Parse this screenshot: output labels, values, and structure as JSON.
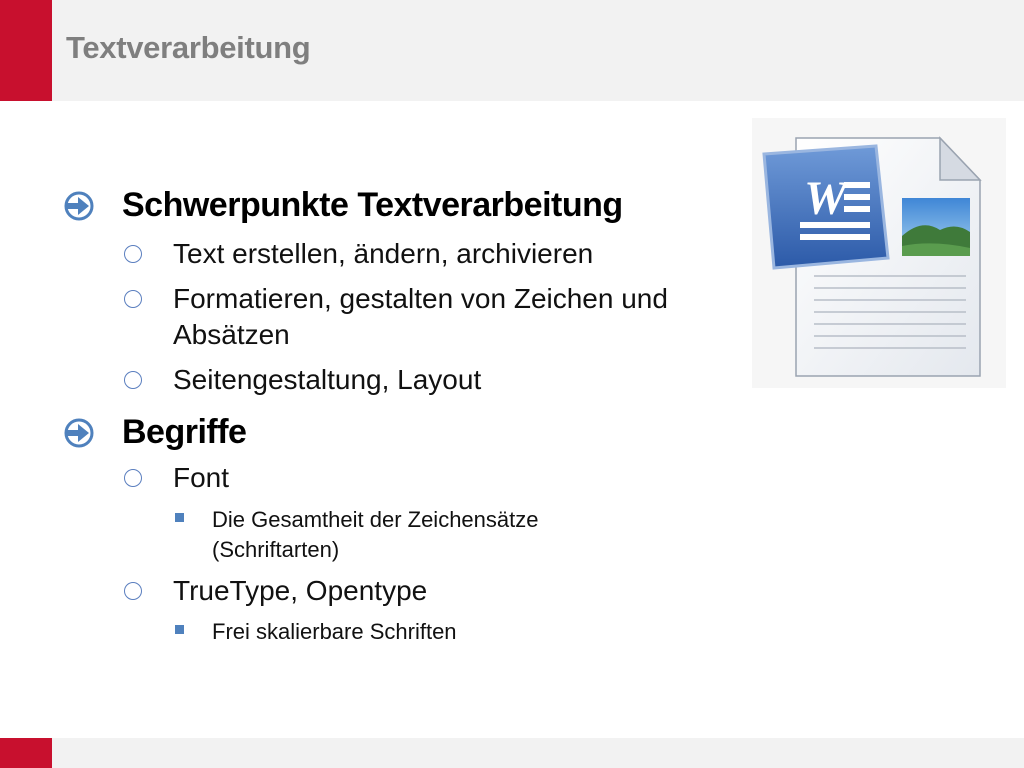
{
  "slide": {
    "title": "Textverarbeitung"
  },
  "bullets": {
    "b1": {
      "label": "Schwerpunkte Textverarbeitung"
    },
    "b1_1": {
      "label": "Text erstellen, ändern, archivieren"
    },
    "b1_2": {
      "line1": "Formatieren, gestalten von Zeichen und",
      "line2": "Absätzen"
    },
    "b1_3": {
      "label": "Seitengestaltung, Layout"
    },
    "b2": {
      "label": "Begriffe"
    },
    "b2_1": {
      "label": "Font"
    },
    "b2_1_1": {
      "line1": "Die Gesamtheit der Zeichensätze",
      "line2": "(Schriftarten)"
    },
    "b2_2": {
      "label": "TrueType, Opentype"
    },
    "b2_2_1": {
      "label": "Frei skalierbare Schriften"
    }
  },
  "icons": {
    "bullet_level1": "arrow-circle-right-icon",
    "bullet_level2": "hollow-circle-icon",
    "bullet_level3": "square-icon",
    "document": "word-document-icon"
  },
  "colors": {
    "accent_red": "#c8102e",
    "header_gray": "#f2f2f2",
    "title_gray": "#7f7f7f",
    "bullet_blue": "#4f81bd",
    "word_blue": "#2b579a"
  },
  "logo": {
    "letter": "W"
  }
}
